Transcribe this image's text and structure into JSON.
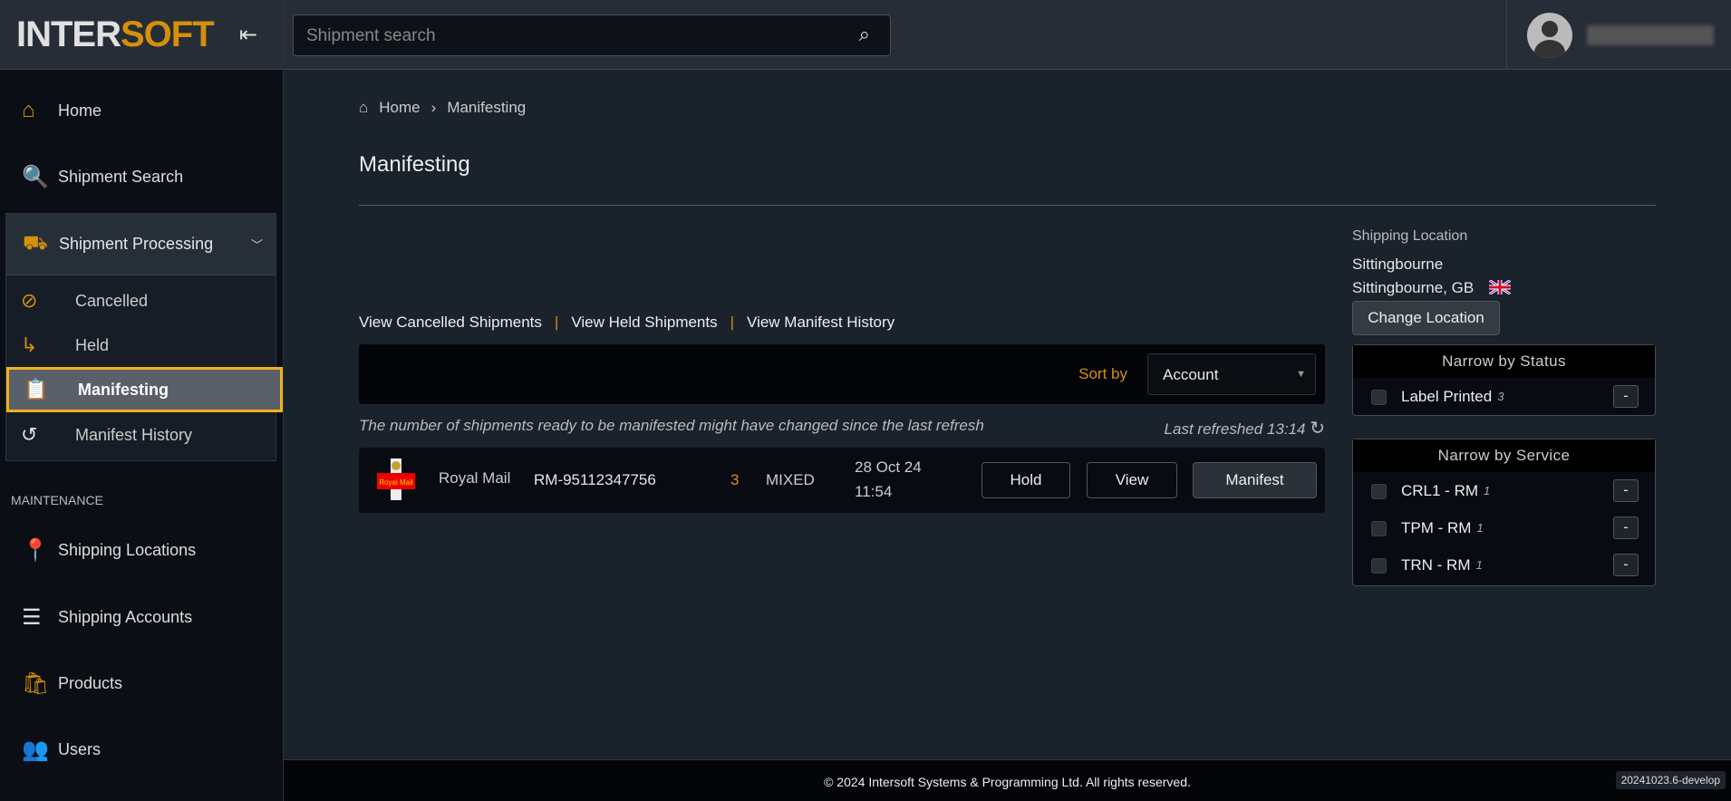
{
  "logo": {
    "part1": "INTER",
    "part2": "SOFT"
  },
  "search": {
    "placeholder": "Shipment search"
  },
  "sidebar": {
    "items": [
      {
        "label": "Home"
      },
      {
        "label": "Shipment Search"
      }
    ],
    "group": {
      "label": "Shipment Processing",
      "children": [
        {
          "label": "Cancelled"
        },
        {
          "label": "Held"
        },
        {
          "label": "Manifesting"
        },
        {
          "label": "Manifest History"
        }
      ]
    },
    "section": "MAINTENANCE",
    "maintenance": [
      {
        "label": "Shipping Locations"
      },
      {
        "label": "Shipping Accounts"
      },
      {
        "label": "Products"
      },
      {
        "label": "Users"
      }
    ]
  },
  "breadcrumb": {
    "home": "Home",
    "current": "Manifesting"
  },
  "page_title": "Manifesting",
  "links": {
    "cancelled": "View Cancelled Shipments",
    "sep": "|",
    "held": "View Held Shipments",
    "history": "View Manifest History"
  },
  "sort": {
    "label": "Sort by",
    "value": "Account"
  },
  "notice": "The number of shipments ready to be manifested might have changed since the last refresh",
  "last_refreshed": "Last refreshed 13:14",
  "rows": [
    {
      "logo_text": "Royal Mail",
      "carrier": "Royal Mail",
      "account": "RM-95112347756",
      "count": "3",
      "type": "MIXED",
      "date": "28 Oct 24",
      "time": "11:54",
      "hold": "Hold",
      "view": "View",
      "manifest": "Manifest"
    }
  ],
  "location": {
    "heading": "Shipping Location",
    "name": "Sittingbourne",
    "city": "Sittingbourne, GB",
    "change": "Change Location"
  },
  "status_filter": {
    "title": "Narrow by Status",
    "items": [
      {
        "label": "Label Printed",
        "count": "3"
      }
    ]
  },
  "service_filter": {
    "title": "Narrow by Service",
    "items": [
      {
        "label": "CRL1 - RM",
        "count": "1"
      },
      {
        "label": "TPM - RM",
        "count": "1"
      },
      {
        "label": "TRN - RM",
        "count": "1"
      }
    ]
  },
  "minus": "-",
  "footer": "© 2024 Intersoft Systems & Programming Ltd. All rights reserved.",
  "version": "20241023.6-develop",
  "colors": {
    "accent": "#d4900a",
    "highlight": "#f2b01e"
  }
}
